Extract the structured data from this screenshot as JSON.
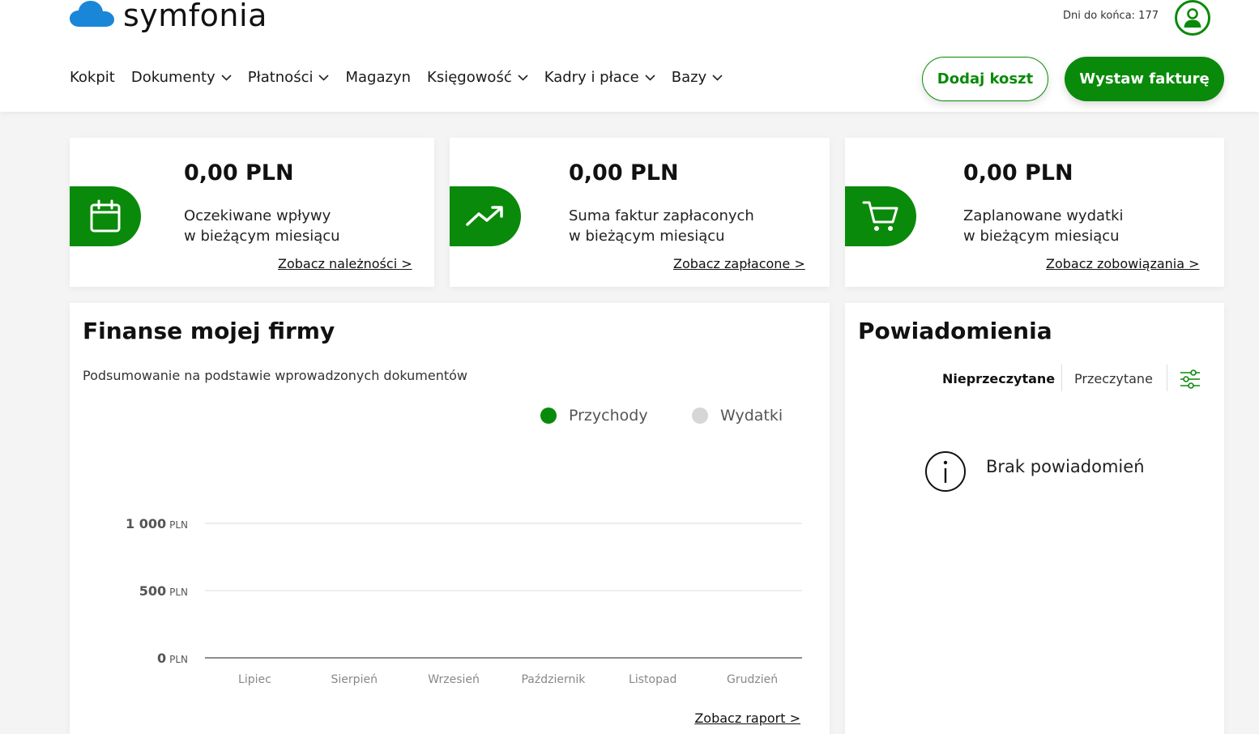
{
  "app": {
    "logo_text": "symfonia"
  },
  "header": {
    "days_left": "Dni do końca: 177",
    "nav": [
      {
        "label": "Kokpit",
        "has_dropdown": false
      },
      {
        "label": "Dokumenty",
        "has_dropdown": true
      },
      {
        "label": "Płatności",
        "has_dropdown": true
      },
      {
        "label": "Magazyn",
        "has_dropdown": false
      },
      {
        "label": "Księgowość",
        "has_dropdown": true
      },
      {
        "label": "Kadry i płace",
        "has_dropdown": true
      },
      {
        "label": "Bazy",
        "has_dropdown": true
      }
    ],
    "add_cost_label": "Dodaj koszt",
    "issue_invoice_label": "Wystaw fakturę"
  },
  "cards": [
    {
      "amount": "0,00 PLN",
      "desc_line1": "Oczekiwane wpływy",
      "desc_line2": "w bieżącym miesiącu",
      "link": "Zobacz należności >",
      "icon": "calendar-icon"
    },
    {
      "amount": "0,00 PLN",
      "desc_line1": "Suma faktur zapłaconych",
      "desc_line2": "w bieżącym miesiącu",
      "link": "Zobacz zapłacone >",
      "icon": "trend-up-icon"
    },
    {
      "amount": "0,00 PLN",
      "desc_line1": "Zaplanowane wydatki",
      "desc_line2": "w bieżącym miesiącu",
      "link": "Zobacz zobowiązania >",
      "icon": "cart-icon"
    }
  ],
  "finance": {
    "title": "Finanse mojej firmy",
    "subtitle": "Podsumowanie na podstawie wprowadzonych dokumentów",
    "report_link": "Zobacz raport >"
  },
  "chart_data": {
    "type": "bar",
    "categories": [
      "Lipiec",
      "Sierpień",
      "Wrzesień",
      "Październik",
      "Listopad",
      "Grudzień"
    ],
    "series": [
      {
        "name": "Przychody",
        "values": [
          0,
          0,
          0,
          0,
          0,
          0
        ],
        "color": "#0a8a0a"
      },
      {
        "name": "Wydatki",
        "values": [
          0,
          0,
          0,
          0,
          0,
          0
        ],
        "color": "#d6d6d6"
      }
    ],
    "y_ticks": [
      {
        "value": 1000,
        "num": "1 000",
        "unit": "PLN"
      },
      {
        "value": 500,
        "num": "500",
        "unit": "PLN"
      },
      {
        "value": 0,
        "num": "0",
        "unit": "PLN"
      }
    ],
    "ylim": [
      0,
      1000
    ],
    "grid": true,
    "legend_position": "top-right"
  },
  "notifications": {
    "title": "Powiadomienia",
    "tab_unread": "Nieprzeczytane",
    "tab_read": "Przeczytane",
    "empty_text": "Brak powiadomień"
  },
  "colors": {
    "brand": "#0a8a0a",
    "muted": "#d6d6d6"
  }
}
